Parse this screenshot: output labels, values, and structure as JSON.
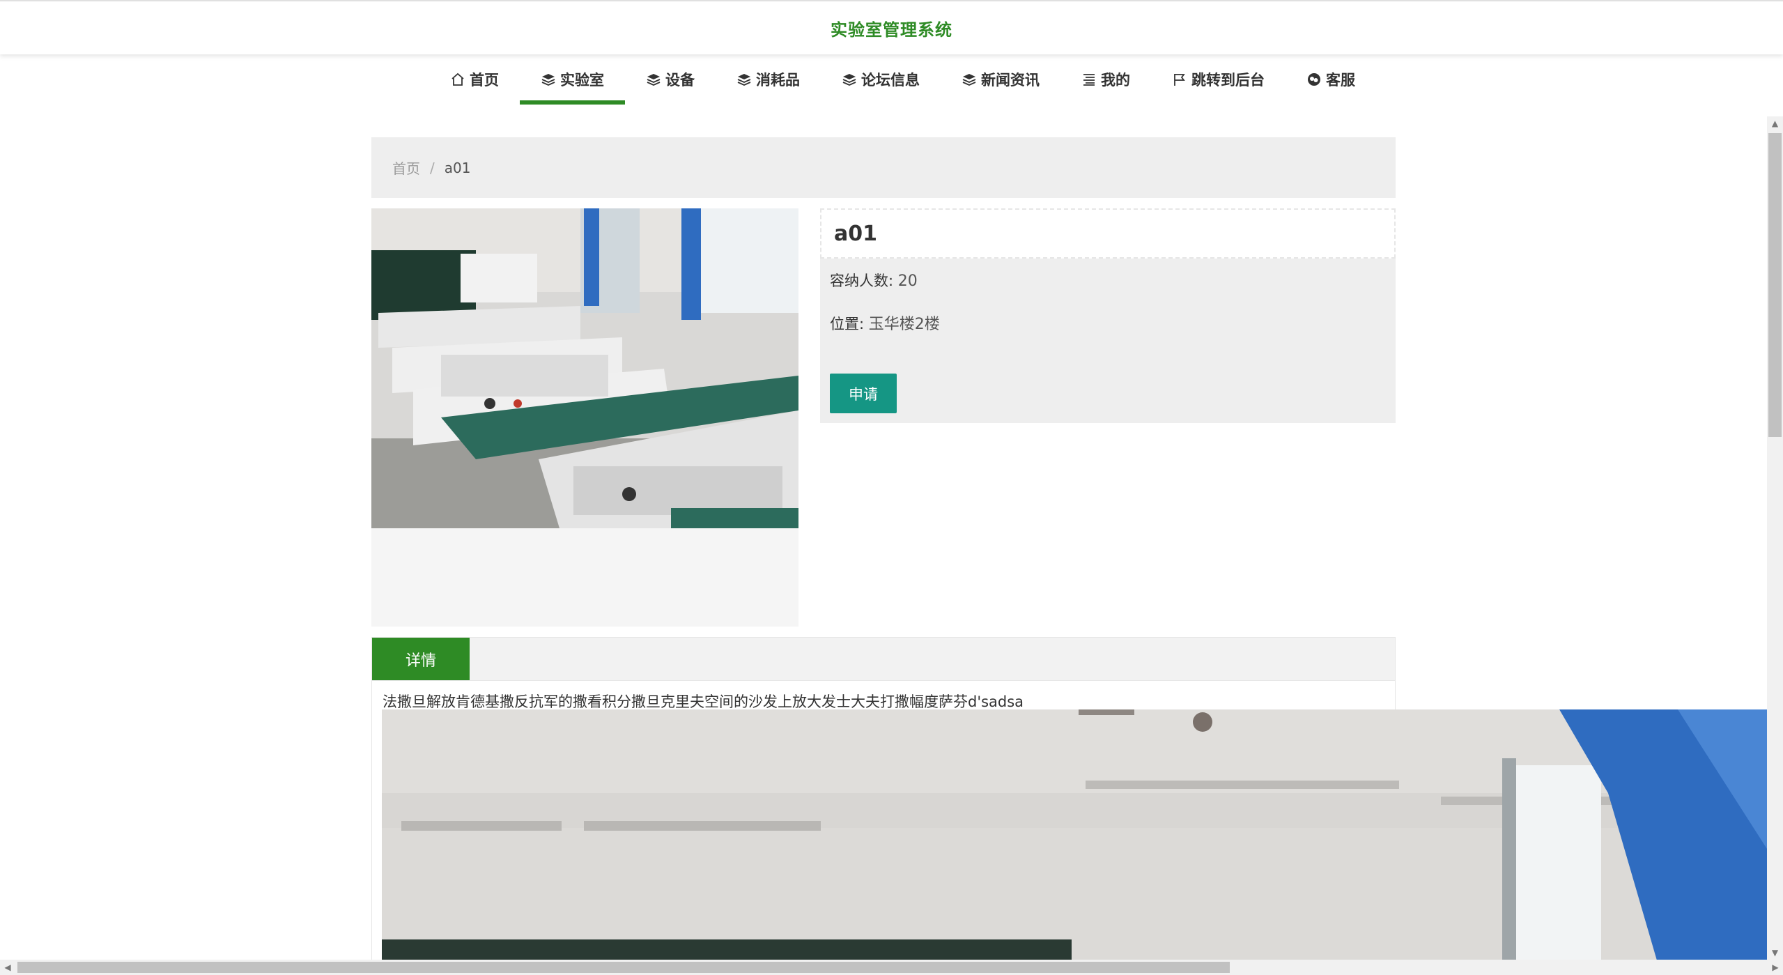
{
  "header": {
    "title": "实验室管理系统"
  },
  "nav": {
    "items": [
      {
        "label": "首页",
        "icon": "home-icon"
      },
      {
        "label": "实验室",
        "icon": "layers-icon",
        "active": true
      },
      {
        "label": "设备",
        "icon": "layers-icon"
      },
      {
        "label": "消耗品",
        "icon": "layers-icon"
      },
      {
        "label": "论坛信息",
        "icon": "layers-icon"
      },
      {
        "label": "新闻资讯",
        "icon": "layers-icon"
      },
      {
        "label": "我的",
        "icon": "list-icon"
      },
      {
        "label": "跳转到后台",
        "icon": "flag-icon"
      },
      {
        "label": "客服",
        "icon": "chat-icon"
      }
    ]
  },
  "breadcrumb": {
    "home": "首页",
    "separator": "/",
    "current": "a01"
  },
  "lab": {
    "name": "a01",
    "capacity_label": "容纳人数:",
    "capacity_value": "20",
    "location_label": "位置:",
    "location_value": "玉华楼2楼",
    "apply_button": "申请"
  },
  "detail": {
    "tab_label": "详情",
    "description": "法撒旦解放肯德基撒反抗军的撒看积分撒旦克里夫空间的沙发上放大发士大夫打撒幅度萨芬d'sadsa"
  },
  "colors": {
    "accent": "#2e8b25",
    "button": "#159684",
    "panel": "#eeeeee"
  }
}
